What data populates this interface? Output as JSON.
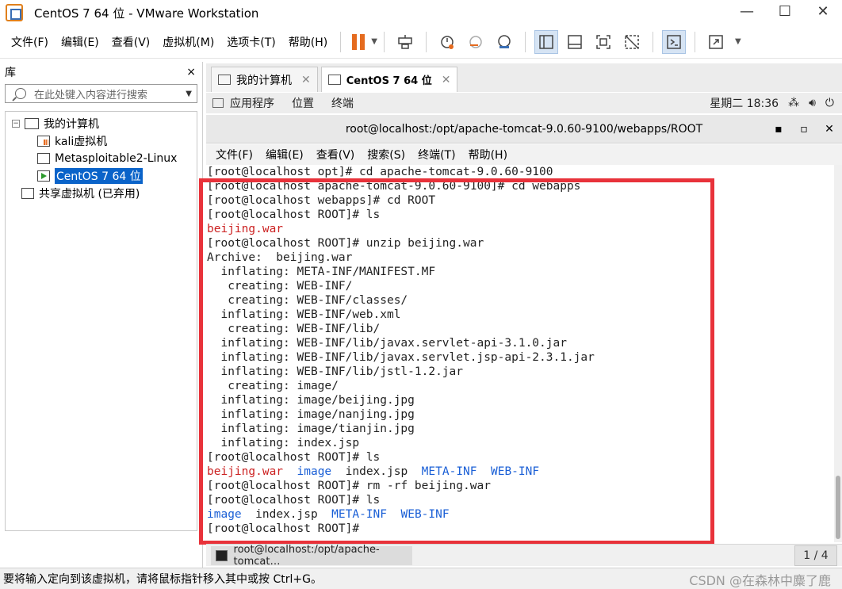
{
  "window": {
    "title": "CentOS 7 64 位 - VMware Workstation"
  },
  "menubar": {
    "items": [
      "文件(F)",
      "编辑(E)",
      "查看(V)",
      "虚拟机(M)",
      "选项卡(T)",
      "帮助(H)"
    ],
    "icons": [
      "pause-icon",
      "send-keys-icon",
      "snapshot-icon",
      "revert-snapshot-icon",
      "snapshot-manager-icon",
      "library-view-icon",
      "console-view-icon",
      "fullscreen-icon",
      "unity-icon",
      "terminal-view-icon",
      "stretch-icon"
    ]
  },
  "library": {
    "title": "库",
    "close": "×",
    "search_placeholder": "在此处键入内容进行搜索",
    "root": "我的计算机",
    "vms": [
      "kali虚拟机",
      "Metasploitable2-Linux",
      "CentOS 7 64 位"
    ],
    "shared": "共享虚拟机 (已弃用)"
  },
  "tabs": [
    {
      "label": "我的计算机",
      "active": false
    },
    {
      "label": "CentOS 7 64 位",
      "active": true
    }
  ],
  "gnome": {
    "apps": "应用程序",
    "places": "位置",
    "terminal": "终端",
    "clock": "星期二 18:36"
  },
  "terminal": {
    "title": "root@localhost:/opt/apache-tomcat-9.0.60-9100/webapps/ROOT",
    "menu": [
      "文件(F)",
      "编辑(E)",
      "查看(V)",
      "搜索(S)",
      "终端(T)",
      "帮助(H)"
    ],
    "lines": [
      "[root@localhost opt]# cd apache-tomcat-9.0.60-9100",
      "[root@localhost apache-tomcat-9.0.60-9100]# cd webapps",
      "[root@localhost webapps]# cd ROOT",
      "[root@localhost ROOT]# ls",
      "beijing.war",
      "[root@localhost ROOT]# unzip beijing.war",
      "Archive:  beijing.war",
      "  inflating: META-INF/MANIFEST.MF",
      "   creating: WEB-INF/",
      "   creating: WEB-INF/classes/",
      "  inflating: WEB-INF/web.xml",
      "   creating: WEB-INF/lib/",
      "  inflating: WEB-INF/lib/javax.servlet-api-3.1.0.jar",
      "  inflating: WEB-INF/lib/javax.servlet.jsp-api-2.3.1.jar",
      "  inflating: WEB-INF/lib/jstl-1.2.jar",
      "   creating: image/",
      "  inflating: image/beijing.jpg",
      "  inflating: image/nanjing.jpg",
      "  inflating: image/tianjin.jpg",
      "  inflating: index.jsp",
      "[root@localhost ROOT]# ls",
      "",
      "[root@localhost ROOT]# rm -rf beijing.war",
      "[root@localhost ROOT]# ls",
      "",
      "[root@localhost ROOT]# "
    ],
    "ls1": {
      "war": "beijing.war",
      "image": "image",
      "index": "index.jsp",
      "meta": "META-INF",
      "web": "WEB-INF"
    },
    "ls2": {
      "image": "image",
      "index": "index.jsp",
      "meta": "META-INF",
      "web": "WEB-INF"
    }
  },
  "taskbar": {
    "item": "root@localhost:/opt/apache-tomcat…",
    "pager": "1 / 4"
  },
  "statusbar": {
    "text": "要将输入定向到该虚拟机，请将鼠标指针移入其中或按 Ctrl+G。",
    "watermark": "CSDN @在森林中麋了鹿"
  },
  "colors": {
    "highlight": "#e8323a",
    "selection": "#0a63c9",
    "war_red": "#cc2222",
    "dir_blue": "#1a5fd6"
  }
}
